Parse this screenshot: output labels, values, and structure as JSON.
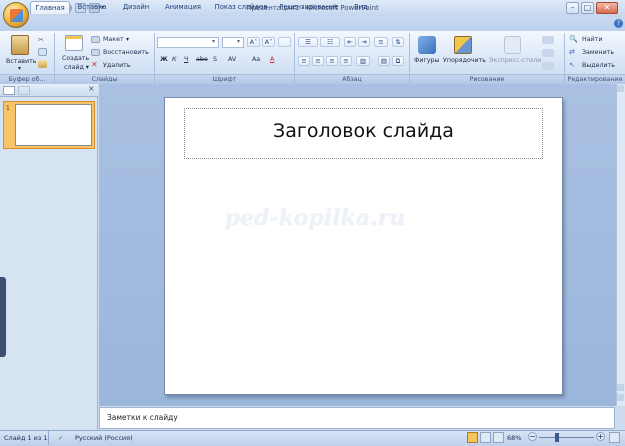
{
  "window": {
    "title": "Презентация1 - Microsoft PowerPoint"
  },
  "tabs": [
    "Главная",
    "Вставка",
    "Дизайн",
    "Анимация",
    "Показ слайдов",
    "Рецензирование",
    "Вид"
  ],
  "ribbon": {
    "groups": [
      "Буфер об...",
      "Слайды",
      "Шрифт",
      "Абзац",
      "Рисование",
      "Редактирование"
    ],
    "paste_label": "Вставить",
    "new_slide_label": "Создать\nслайд",
    "layout_label": "Макет",
    "reset_label": "Восстановить",
    "delete_label": "Удалить",
    "shapes_label": "Фигуры",
    "arrange_label": "Упорядочить",
    "quick_styles_label": "Экспресс-стили",
    "find_label": "Найти",
    "replace_label": "Заменить",
    "select_label": "Выделить",
    "font_buttons": [
      "Ж",
      "К",
      "Ч",
      "abe",
      "S",
      "AV",
      "Aa",
      "A"
    ],
    "grow_font": "A˄",
    "shrink_font": "A˅"
  },
  "slide": {
    "title": "Заголовок слайда",
    "watermark": "ped-kopilka.ru",
    "number": "1"
  },
  "notes": {
    "placeholder": "Заметки к слайду"
  },
  "status": {
    "slide_info": "Слайд 1 из 1",
    "language": "Русский (Россия)",
    "zoom": "68%",
    "zoom_value": 68
  },
  "colors": {
    "accent": "#21427a",
    "selected_thumb": "#f9c36a",
    "ribbon_bg": "#dbe7f7"
  }
}
